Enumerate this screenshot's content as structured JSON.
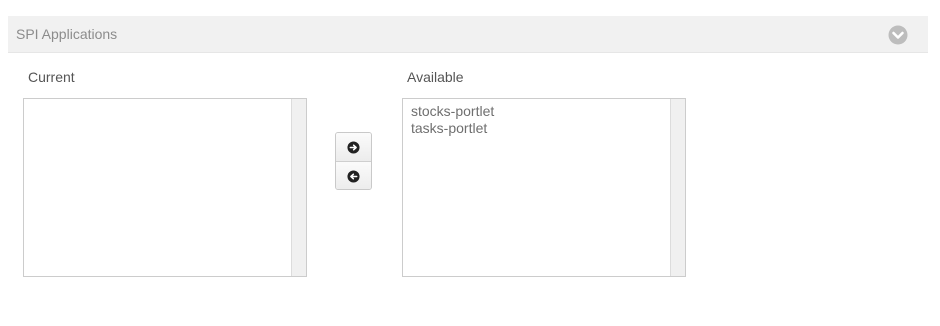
{
  "panel": {
    "title": "SPI Applications",
    "toggle_icon": "chevron-circle-down-icon"
  },
  "current": {
    "label": "Current",
    "items": []
  },
  "available": {
    "label": "Available",
    "items": [
      "stocks-portlet",
      "tasks-portlet"
    ]
  },
  "controls": {
    "move_right_icon": "arrow-circle-right-icon",
    "move_left_icon": "arrow-circle-left-icon"
  },
  "colors": {
    "header_bg": "#f1f1f1",
    "header_text": "#8c8c8c",
    "toggle_icon": "#bdbdbd",
    "list_text": "#6f6f6f"
  }
}
